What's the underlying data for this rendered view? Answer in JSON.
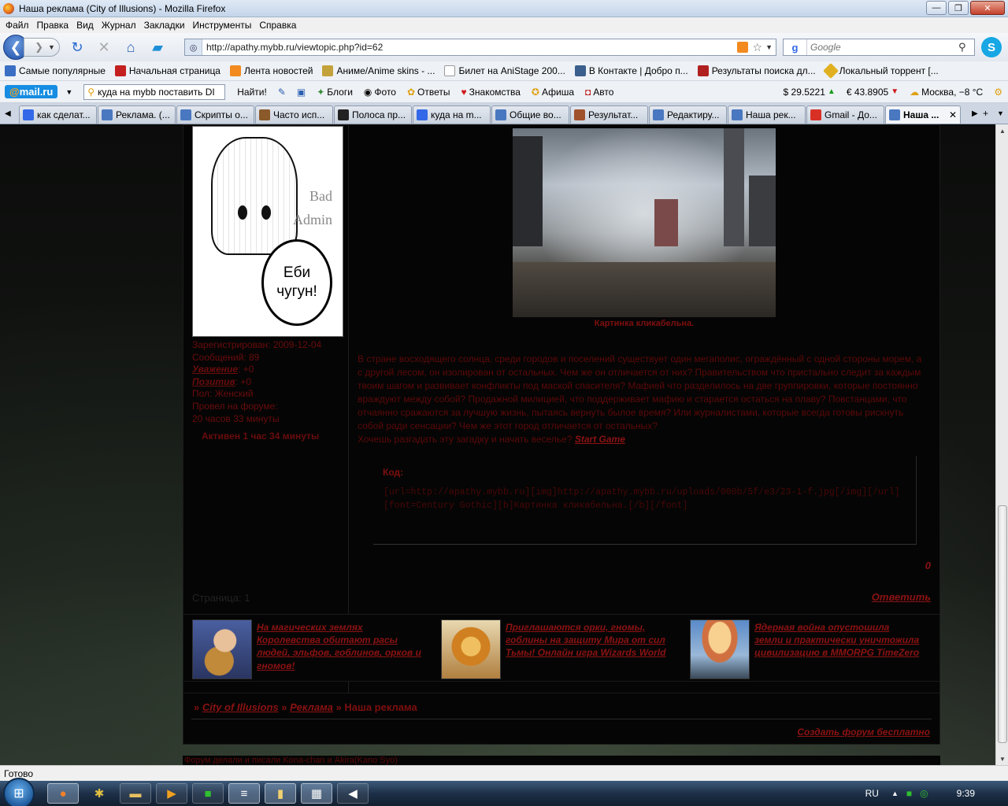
{
  "window": {
    "title": "Наша реклама (City of Illusions) - Mozilla Firefox",
    "buttons": [
      "—",
      "❐",
      "✕"
    ]
  },
  "menu": [
    "Файл",
    "Правка",
    "Вид",
    "Журнал",
    "Закладки",
    "Инструменты",
    "Справка"
  ],
  "nav": {
    "url": "http://apathy.mybb.ru/viewtopic.php?id=62",
    "search_placeholder": "Google"
  },
  "bookmarks": [
    {
      "label": "Самые популярные",
      "color": "#3b6fc4"
    },
    {
      "label": "Начальная страница",
      "color": "#c42020"
    },
    {
      "label": "Лента новостей",
      "color": "#f28a1f"
    },
    {
      "label": "Аниме/Anime skins - ...",
      "color": "#c4a23b"
    },
    {
      "label": "Билет на AniStage 200...",
      "color": "#ffffff"
    },
    {
      "label": "В Контакте | Добро п...",
      "color": "#3b5f8c"
    },
    {
      "label": "Результаты поиска дл...",
      "color": "#b02020"
    },
    {
      "label": "Локальный торрент [...",
      "color": "#e0b020"
    }
  ],
  "mailbar": {
    "logo_at": "@",
    "logo_text": "mail.ru",
    "search_value": "куда на mybb поставить DI",
    "find_button": "Найти!",
    "links": [
      "Блоги",
      "Фото",
      "Ответы",
      "Знакомства",
      "Афиша",
      "Авто"
    ],
    "usd": "$ 29.5221",
    "eur": "€ 43.8905",
    "weather": "Москва, −8 °C"
  },
  "tabs": [
    "как сделат...",
    "Реклама. (...",
    "Скрипты о...",
    "Часто исп...",
    "Полоса пр...",
    "куда на m...",
    "Общие во...",
    "Результат...",
    "Редактиру...",
    "Наша рек...",
    "Gmail - До...",
    "Наша ..."
  ],
  "profile": {
    "avatar_text_1": "Bad",
    "avatar_text_2": "Admin",
    "avatar_bubble": "Еби чугун!",
    "registered": "Зарегистрирован: 2009-12-04",
    "messages": "Сообщений: 89",
    "respect_label": "Уважение",
    "respect_value": ": +0",
    "positive_label": "Позитив",
    "positive_value": ": +0",
    "gender": "Пол: Женский",
    "online_label": "Провел на форуме:",
    "online_value": "20 часов 33 минуты",
    "active": "Активен 1 час 34 минуты"
  },
  "post": {
    "caption": "Картинка кликабельна.",
    "text": "В стране восходящего солнца, среди городов и поселений существует один мегаполис, ограждённый с одной стороны морем, а с другой лесом, он изолирован от остальных. Чем же он отличается от них? Правительством что пристально следит за каждым твоим шагом и развивает конфликты под маской спасителя? Мафией что разделилось на две группировки, которые постоянно враждуют между собой? Продажной милицией, что поддерживает мафию и старается остаться на плаву? Повстанцами, что отчаянно сражаются за лучшую жизнь, пытаясь вернуть былое время? Или журналистами, которые всегда готовы рискнуть собой ради сенсации? Чем же этот город отличается от остальных?",
    "question": "Хочешь разгадать эту загадку и начать веселье? ",
    "start_game": "Start Game",
    "code_label": "Код:",
    "code_line_1": "[url=http://apathy.mybb.ru][img]http://apathy.mybb.ru/uploads/000b/5f/e3/23-1-f.jpg[/img][/url]",
    "code_line_2": "[font=Century Gothic][b]Картинка кликабельна.[/b][/font]",
    "post_number": "0"
  },
  "pagination": {
    "pages": "Страница: 1",
    "reply": "Ответить"
  },
  "ads": [
    {
      "text": "На магических землях Королевства обитают расы людей, эльфов, гоблинов, орков и гномов!"
    },
    {
      "text": "Приглашаются орки, гномы, гоблины на защиту Мира от сил Тьмы! Онлайн игра Wizards World"
    },
    {
      "text": "Ядерная война опустошила земли и практически уничтожила цивилизацию в MMORPG TimeZero"
    }
  ],
  "breadcrumbs": {
    "prefix": "» ",
    "forum": "City of Illusions",
    "sep": " » ",
    "section": "Реклама",
    "current": "Наша реклама",
    "create_forum": "Создать форум бесплатно"
  },
  "footer": "Форум делали и писали Kona-chan и Akira(Kano Syo)",
  "status": "Готово",
  "taskbar": {
    "lang": "RU",
    "time": "9:39"
  }
}
